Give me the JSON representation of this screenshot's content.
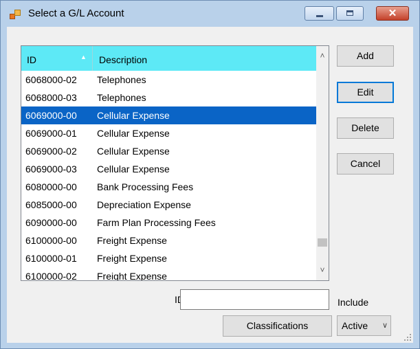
{
  "window": {
    "title": "Select a G/L Account",
    "buttons": {
      "minimize": "minimize",
      "maximize": "maximize",
      "close": "✕"
    }
  },
  "grid": {
    "columns": {
      "id": "ID",
      "description": "Description"
    },
    "sort_indicator": "▲",
    "rows": [
      {
        "id": "6068000-02",
        "description": "Telephones"
      },
      {
        "id": "6068000-03",
        "description": "Telephones"
      },
      {
        "id": "6069000-00",
        "description": "Cellular Expense",
        "selected": true
      },
      {
        "id": "6069000-01",
        "description": "Cellular Expense"
      },
      {
        "id": "6069000-02",
        "description": "Cellular Expense"
      },
      {
        "id": "6069000-03",
        "description": "Cellular Expense"
      },
      {
        "id": "6080000-00",
        "description": "Bank Processing Fees"
      },
      {
        "id": "6085000-00",
        "description": "Depreciation Expense"
      },
      {
        "id": "6090000-00",
        "description": "Farm Plan Processing Fees"
      },
      {
        "id": "6100000-00",
        "description": "Freight Expense"
      },
      {
        "id": "6100000-01",
        "description": "Freight Expense"
      },
      {
        "id": "6100000-02",
        "description": "Freight Expense"
      }
    ],
    "scroll_up": "˄",
    "scroll_down": "˅"
  },
  "actions": {
    "add": "Add",
    "edit": "Edit",
    "delete": "Delete",
    "cancel": "Cancel",
    "classifications": "Classifications"
  },
  "filter": {
    "id_label": "ID",
    "id_value": "",
    "include_label": "Include",
    "include_value": "Active"
  },
  "colors": {
    "header_bg": "#5de9f6",
    "selection_bg": "#0a64c6",
    "titlebar_bg": "#b9d1ea"
  }
}
